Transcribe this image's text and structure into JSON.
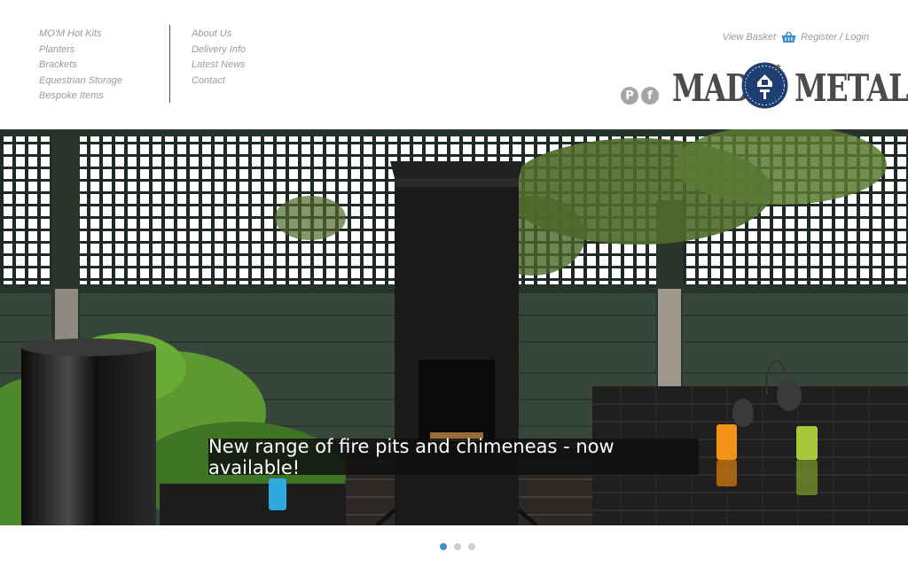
{
  "nav": {
    "col1": [
      "MO'M Hot Kits",
      "Planters",
      "Brackets",
      "Equestrian Storage",
      "Bespoke Items"
    ],
    "col2": [
      "About Us",
      "Delivery Info",
      "Latest News",
      "Contact"
    ]
  },
  "account": {
    "basket_label": "View Basket",
    "register_label": "Register",
    "separator": "/",
    "login_label": "Login"
  },
  "social": {
    "pinterest_glyph": "P",
    "facebook_glyph": "f"
  },
  "logo": {
    "word_left": "MADE",
    "word_right": "METAL"
  },
  "hero": {
    "caption": "New range of fire pits and chimeneas - now available!"
  },
  "slider": {
    "slide_count": 3,
    "active_index": 0
  },
  "colors": {
    "accent": "#3b8fc6",
    "nav_text": "#9a9a9a",
    "logo_navy": "#1f3f73"
  },
  "icons": [
    "basket-icon",
    "pinterest-icon",
    "facebook-icon",
    "logo-badge-icon"
  ]
}
